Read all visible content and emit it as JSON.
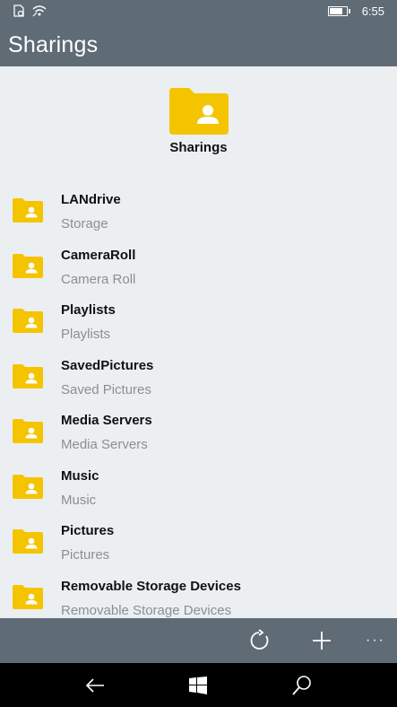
{
  "status_bar": {
    "time": "6:55",
    "battery_level": 0.7,
    "icons": [
      "sim-icon",
      "wifi-icon",
      "battery-icon"
    ]
  },
  "header": {
    "title": "Sharings"
  },
  "hero": {
    "icon": "folder-user-icon",
    "title": "Sharings"
  },
  "items": [
    {
      "title": "LANdrive",
      "subtitle": "Storage"
    },
    {
      "title": "CameraRoll",
      "subtitle": "Camera Roll"
    },
    {
      "title": "Playlists",
      "subtitle": "Playlists"
    },
    {
      "title": "SavedPictures",
      "subtitle": "Saved Pictures"
    },
    {
      "title": "Media Servers",
      "subtitle": "Media Servers"
    },
    {
      "title": "Music",
      "subtitle": "Music"
    },
    {
      "title": "Pictures",
      "subtitle": "Pictures"
    },
    {
      "title": "Removable Storage Devices",
      "subtitle": "Removable Storage Devices"
    }
  ],
  "app_bar": {
    "buttons": [
      "refresh-icon",
      "add-icon",
      "more-icon"
    ]
  },
  "nav_bar": {
    "buttons": [
      "back-icon",
      "windows-icon",
      "search-icon"
    ]
  },
  "colors": {
    "folder": "#f5c400",
    "header": "#5f6b75",
    "background": "#eceff1"
  }
}
